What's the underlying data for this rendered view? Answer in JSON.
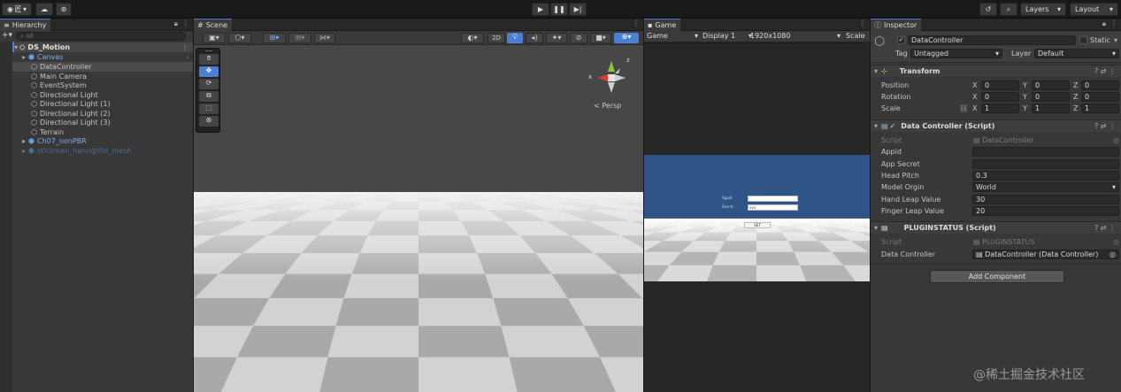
{
  "toolbar": {
    "account_label": "匠",
    "layers_label": "Layers",
    "layout_label": "Layout"
  },
  "hierarchy": {
    "tab_title": "Hierarchy",
    "search_placeholder": "All",
    "scene_name": "DS_Motion",
    "items": [
      {
        "label": "Canvas"
      },
      {
        "label": "DataController"
      },
      {
        "label": "Main Camera"
      },
      {
        "label": "EventSystem"
      },
      {
        "label": "Directional Light"
      },
      {
        "label": "Directional Light (1)"
      },
      {
        "label": "Directional Light (2)"
      },
      {
        "label": "Directional Light (3)"
      },
      {
        "label": "Terrain"
      },
      {
        "label": "Ch07_nonPBR"
      },
      {
        "label": "stickman_hand@fist_mesh"
      }
    ]
  },
  "scene": {
    "tab_title": "Scene",
    "mode_2d": "2D",
    "persp_label": "Persp",
    "gizmo_x": "x",
    "gizmo_z": "z"
  },
  "game": {
    "tab_title": "Game",
    "mode": "Game",
    "display": "Display 1",
    "resolution": "1920x1080",
    "scale": "Scale",
    "form_label_1": "Appid",
    "form_label_2": "Secret",
    "form_value_2": "xxx",
    "button_label": "SET"
  },
  "inspector": {
    "tab_title": "Inspector",
    "object_name": "DataController",
    "static_label": "Static",
    "tag_label": "Tag",
    "tag_value": "Untagged",
    "layer_label": "Layer",
    "layer_value": "Default",
    "transform": {
      "title": "Transform",
      "position_label": "Position",
      "rotation_label": "Rotation",
      "scale_label": "Scale",
      "position": [
        "0",
        "0",
        "0"
      ],
      "rotation": [
        "0",
        "0",
        "0"
      ],
      "scale": [
        "1",
        "1",
        "1"
      ],
      "x": "X",
      "y": "Y",
      "z": "Z"
    },
    "data_controller": {
      "title": "Data Controller (Script)",
      "script_label": "Script",
      "script_value": "DataController",
      "appid_label": "Appid",
      "appid_value": "",
      "app_secret_label": "App Secret",
      "app_secret_value": "",
      "head_pitch_label": "Head Pitch",
      "head_pitch_value": "0.3",
      "model_origin_label": "Model Orgin",
      "model_origin_value": "World",
      "hand_leap_label": "Hand Leap Value",
      "hand_leap_value": "30",
      "finger_leap_label": "Finger Leap Value",
      "finger_leap_value": "20"
    },
    "plugin_status": {
      "title": "PLUGINSTATUS (Script)",
      "script_label": "Script",
      "script_value": "PLUGINSTATUS",
      "dc_label": "Data Controller",
      "dc_value": "DataController (Data Controller)"
    },
    "add_component": "Add Component"
  },
  "watermark": "@稀土掘金技术社区",
  "colors": {
    "accent": "#4a7fd4",
    "game_sky": "#2f5486",
    "selection": "#2c5d87"
  }
}
